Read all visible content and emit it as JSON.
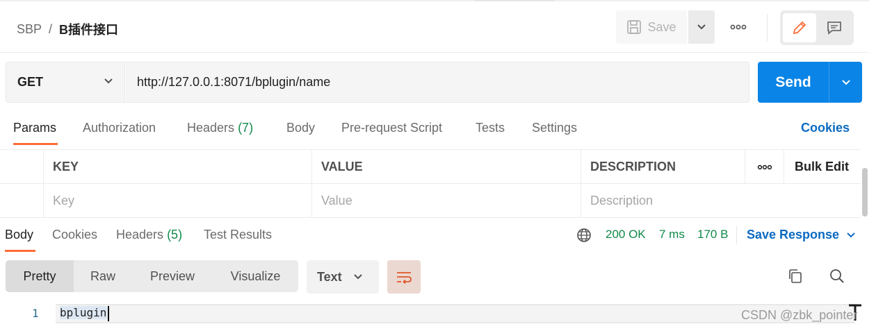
{
  "breadcrumb": {
    "parent": "SBP",
    "separator": "/",
    "current": "B插件接口"
  },
  "toolbar": {
    "save_label": "Save",
    "more_icon": "ellipsis-icon",
    "edit_icon": "pencil-icon",
    "comment_icon": "comment-icon"
  },
  "request": {
    "method": "GET",
    "url": "http://127.0.0.1:8071/bplugin/name",
    "send_label": "Send"
  },
  "request_tabs": [
    {
      "label": "Params",
      "active": true
    },
    {
      "label": "Authorization"
    },
    {
      "label": "Headers",
      "count": "(7)"
    },
    {
      "label": "Body"
    },
    {
      "label": "Pre-request Script"
    },
    {
      "label": "Tests"
    },
    {
      "label": "Settings"
    }
  ],
  "cookies_link": "Cookies",
  "params": {
    "headers": {
      "key": "KEY",
      "value": "VALUE",
      "description": "DESCRIPTION",
      "bulk_edit": "Bulk Edit"
    },
    "placeholders": {
      "key": "Key",
      "value": "Value",
      "description": "Description"
    }
  },
  "response_tabs": [
    {
      "label": "Body",
      "active": true
    },
    {
      "label": "Cookies"
    },
    {
      "label": "Headers",
      "count": "(5)"
    },
    {
      "label": "Test Results"
    }
  ],
  "response_status": {
    "status": "200 OK",
    "time": "7 ms",
    "size": "170 B"
  },
  "save_response_label": "Save Response",
  "view_modes": [
    "Pretty",
    "Raw",
    "Preview",
    "Visualize"
  ],
  "active_view_mode": "Pretty",
  "format": "Text",
  "response_body": {
    "line_number": "1",
    "content": "bplugin"
  },
  "watermark": "CSDN @zbk_pointer",
  "colors": {
    "accent_orange": "#ff6c37",
    "send_blue": "#0a84e6",
    "link_blue": "#0b6ac2",
    "success_green": "#0f8a4a"
  }
}
